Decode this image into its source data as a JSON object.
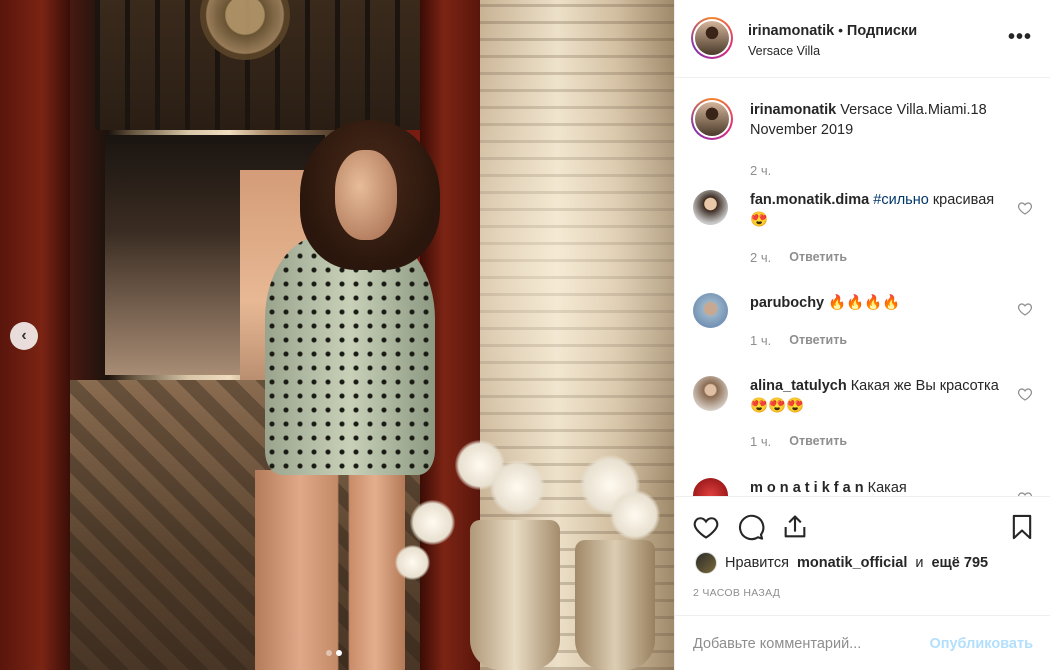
{
  "post": {
    "author": "irinamonatik",
    "separator": " • ",
    "follow_label": "Подписки",
    "location": "Versace Villa",
    "more_icon": "more-horizontal-icon",
    "carousel": {
      "prev_icon": "chevron-left-icon",
      "prev_glyph": "‹",
      "slides": 2,
      "active": 2
    }
  },
  "caption": {
    "user": "irinamonatik",
    "text": "Versace Villa.Miami.18 November 2019",
    "time": "2 ч."
  },
  "comments": [
    {
      "user": "fan.monatik.dima",
      "hashtag": "#сильно",
      "text": "красивая😍",
      "time": "2 ч.",
      "reply": "Ответить"
    },
    {
      "user": "parubochy",
      "text": "🔥🔥🔥🔥",
      "time": "1 ч.",
      "reply": "Ответить"
    },
    {
      "user": "alina_tatulych",
      "text": "Какая же Вы красотка😍😍😍",
      "time": "1 ч.",
      "reply": "Ответить"
    },
    {
      "user": "m o n a t i k f a n",
      "text": "Какая"
    }
  ],
  "actions": {
    "like_icon": "heart-icon",
    "comment_icon": "comment-icon",
    "share_icon": "share-icon",
    "save_icon": "bookmark-icon"
  },
  "likes": {
    "prefix": "Нравится",
    "user": "monatik_official",
    "middle": "и",
    "count": "ещё 795"
  },
  "time_ago": "2 ЧАСОВ НАЗАД",
  "add_comment": {
    "placeholder": "Добавьте комментарий...",
    "publish_label": "Опубликовать"
  },
  "colors": {
    "link": "#00376b",
    "muted": "#8e8e8e",
    "publish_disabled": "#b2dffc",
    "border": "#efefef"
  }
}
